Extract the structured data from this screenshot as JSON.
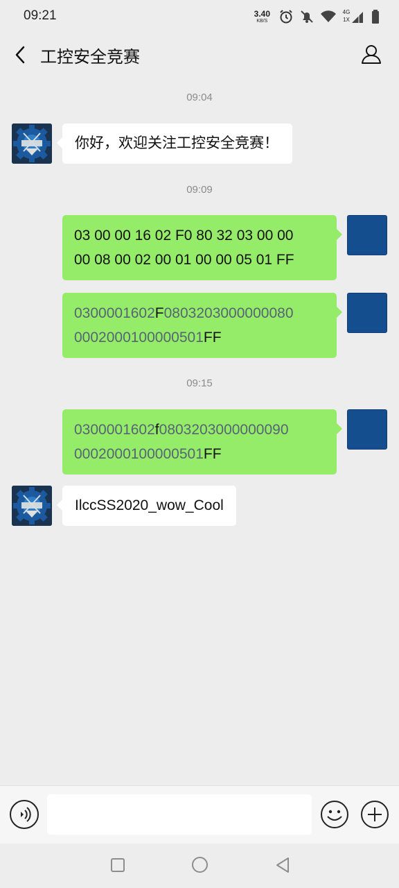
{
  "status_bar": {
    "time": "09:21",
    "net_speed_value": "3.40",
    "net_speed_unit": "KB/S",
    "sig_top": "4G",
    "sig_bottom": "1X",
    "icons": [
      "alarm-icon",
      "mute-icon",
      "wifi-icon",
      "signal-icon",
      "battery-icon"
    ]
  },
  "header": {
    "title": "工控安全竞赛"
  },
  "timestamps": [
    "09:04",
    "09:09",
    "09:15"
  ],
  "messages": {
    "m1": {
      "text": "你好，欢迎关注工控安全竞赛！"
    },
    "m2": {
      "line1": "03 00 00 16 02 F0 80 32 03 00 00",
      "line2": "00 08 00 02 00 01 00 00 05 01 FF"
    },
    "m3": {
      "l1a": "0300001602",
      "l1b": "F",
      "l1c": "0803203000000080",
      "l2a": "00020001000005",
      "l2b": "01",
      "l2c": "FF"
    },
    "m4": {
      "l1a": "0300001602",
      "l1b": "f",
      "l1c": "0803203000000090",
      "l2a": "00020001000005",
      "l2b": "01",
      "l2c": "FF"
    },
    "m5": {
      "text": "IlccSS2020_wow_Cool"
    }
  },
  "colors": {
    "background": "#ededed",
    "bubble_self": "#95ec69",
    "bubble_other": "#ffffff",
    "avatar_self": "#154e8e"
  },
  "input_bar": {
    "placeholder": ""
  }
}
